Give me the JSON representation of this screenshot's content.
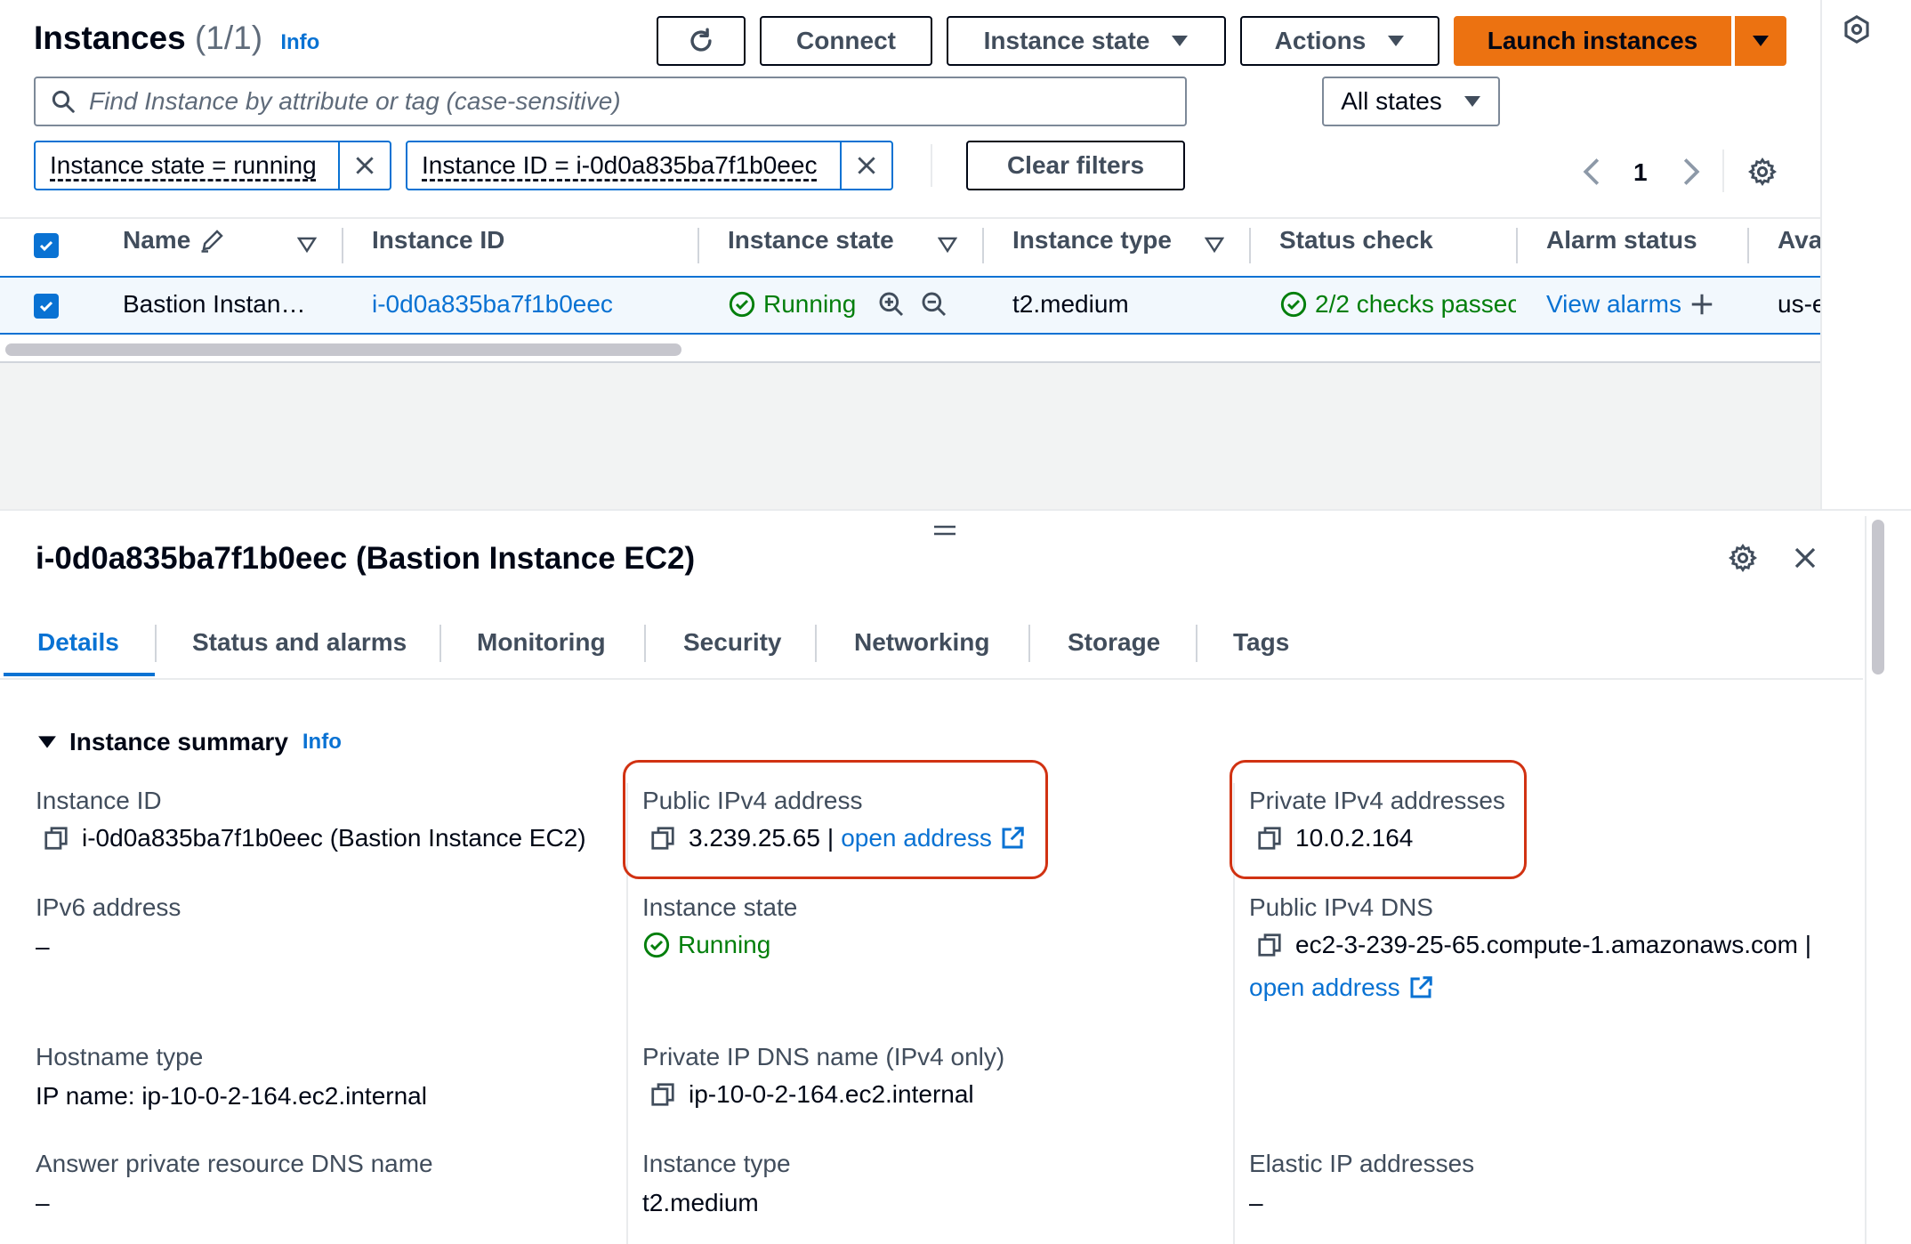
{
  "header": {
    "title": "Instances",
    "count": "(1/1)",
    "info": "Info"
  },
  "toolbar": {
    "connect": "Connect",
    "instance_state": "Instance state",
    "actions": "Actions",
    "launch": "Launch instances"
  },
  "search": {
    "placeholder": "Find Instance by attribute or tag (case-sensitive)"
  },
  "state_filter": {
    "selected": "All states"
  },
  "filters": [
    {
      "label": "Instance state = running"
    },
    {
      "label": "Instance ID = i-0d0a835ba7f1b0eec"
    }
  ],
  "clear_filters": "Clear filters",
  "pagination": {
    "page": "1"
  },
  "table": {
    "columns": [
      "Name",
      "Instance ID",
      "Instance state",
      "Instance type",
      "Status check",
      "Alarm status",
      "Ava"
    ],
    "rows": [
      {
        "name": "Bastion Instan…",
        "instance_id": "i-0d0a835ba7f1b0eec",
        "state": "Running",
        "type": "t2.medium",
        "status_check": "2/2 checks passec",
        "alarm_status": "View alarms",
        "az": "us-e"
      }
    ]
  },
  "detail": {
    "title": "i-0d0a835ba7f1b0eec (Bastion Instance EC2)",
    "tabs": [
      "Details",
      "Status and alarms",
      "Monitoring",
      "Security",
      "Networking",
      "Storage",
      "Tags"
    ],
    "section": "Instance summary",
    "section_info": "Info",
    "fields": {
      "instance_id_label": "Instance ID",
      "instance_id_value": "i-0d0a835ba7f1b0eec (Bastion Instance EC2)",
      "public_ipv4_label": "Public IPv4 address",
      "public_ipv4_value": "3.239.25.65",
      "public_ipv4_sep": "|",
      "open_address": "open address",
      "private_ipv4_label": "Private IPv4 addresses",
      "private_ipv4_value": "10.0.2.164",
      "ipv6_label": "IPv6 address",
      "ipv6_value": "–",
      "instance_state_label": "Instance state",
      "instance_state_value": "Running",
      "public_dns_label": "Public IPv4 DNS",
      "public_dns_value": "ec2-3-239-25-65.compute-1.amazonaws.com |",
      "hostname_type_label": "Hostname type",
      "hostname_type_value": "IP name: ip-10-0-2-164.ec2.internal",
      "private_dns_label": "Private IP DNS name (IPv4 only)",
      "private_dns_value": "ip-10-0-2-164.ec2.internal",
      "answer_dns_label": "Answer private resource DNS name",
      "answer_dns_value": "–",
      "instance_type_label": "Instance type",
      "instance_type_value": "t2.medium",
      "elastic_ip_label": "Elastic IP addresses",
      "elastic_ip_value": "–"
    }
  },
  "colors": {
    "accent": "#0972d3",
    "primary_button": "#ec7211",
    "success": "#037f0c",
    "highlight": "#d13212"
  }
}
